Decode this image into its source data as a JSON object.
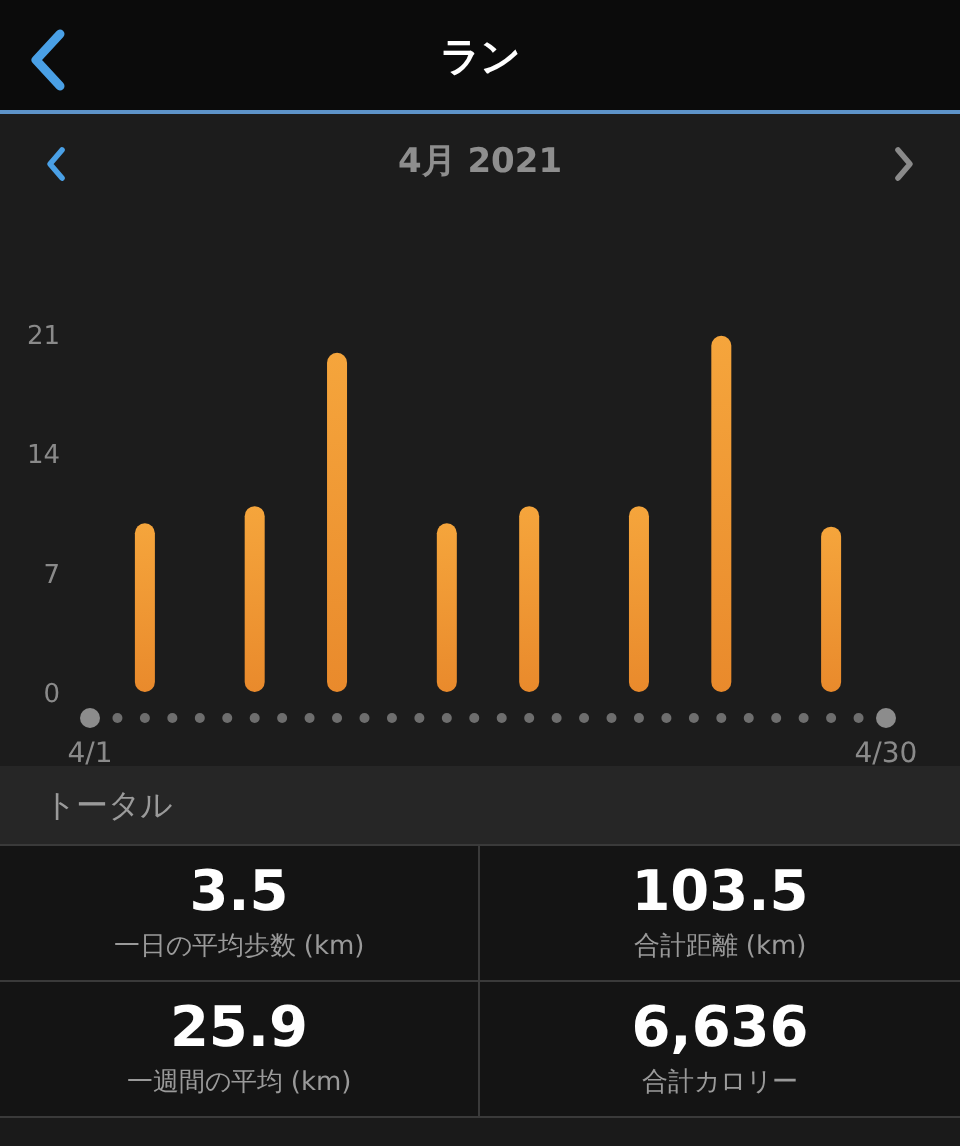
{
  "header": {
    "title": "ラン"
  },
  "period": {
    "label": "4月 2021"
  },
  "chart": {
    "chart_data": {
      "type": "bar",
      "categories": [
        "4/1",
        null,
        null,
        null,
        null,
        null,
        null,
        null,
        null,
        null,
        null,
        null,
        null,
        null,
        null,
        null,
        null,
        null,
        null,
        null,
        null,
        null,
        null,
        null,
        null,
        null,
        null,
        null,
        null,
        "4/30"
      ],
      "values": [
        null,
        null,
        9.9,
        null,
        null,
        null,
        10.9,
        null,
        null,
        19.9,
        null,
        null,
        null,
        9.9,
        null,
        null,
        10.9,
        null,
        null,
        null,
        10.9,
        null,
        null,
        20.9,
        null,
        null,
        null,
        9.7,
        null,
        null
      ],
      "ylim": [
        0,
        21
      ],
      "yticks": [
        0,
        7,
        14,
        21
      ]
    }
  },
  "totals": {
    "title": "トータル",
    "stats": [
      {
        "value": "3.5",
        "label": "一日の平均歩数 (km)"
      },
      {
        "value": "103.5",
        "label": "合計距離 (km)"
      },
      {
        "value": "25.9",
        "label": "一週間の平均 (km)"
      },
      {
        "value": "6,636",
        "label": "合計カロリー"
      }
    ]
  }
}
